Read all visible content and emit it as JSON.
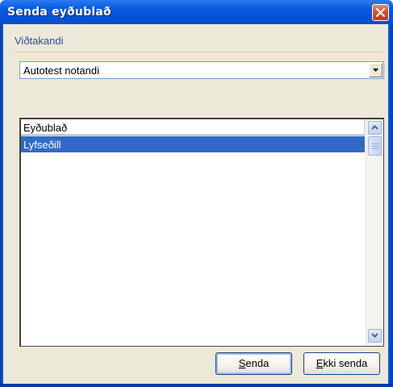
{
  "window": {
    "title": "Senda eyðublað",
    "close_icon": "close-icon"
  },
  "recipient": {
    "group_label": "Viðtakandi",
    "selected": "Autotest notandi",
    "dropdown_icon": "chevron-down-icon"
  },
  "forms_list": {
    "column_header": "Eyðublað",
    "items": [
      {
        "label": "Lyfseðill",
        "selected": true
      }
    ]
  },
  "buttons": {
    "send": {
      "mnemonic": "S",
      "rest": "enda"
    },
    "dont_send": {
      "mnemonic": "E",
      "rest": "kki senda"
    }
  },
  "colors": {
    "titlebar": "#0a5be0",
    "selection": "#316ac5",
    "dialog_bg": "#ece9d8",
    "close_button": "#d9522d"
  }
}
